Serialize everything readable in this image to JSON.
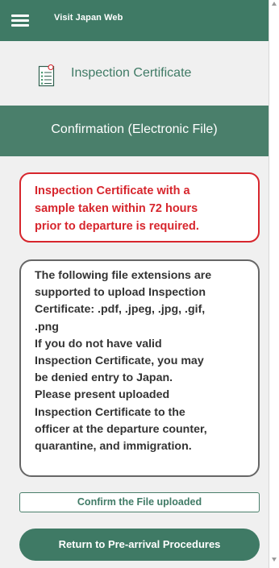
{
  "header": {
    "brand": "Visit Japan Web",
    "menu_icon": "hamburger-menu-icon"
  },
  "page": {
    "title": "Inspection Certificate",
    "title_icon": "document-checklist-icon"
  },
  "section": {
    "title": "Confirmation (Electronic File)"
  },
  "alert": {
    "lines": [
      "Inspection Certificate with a",
      "sample taken within 72 hours",
      "prior to departure is required."
    ],
    "color": "#d7262d"
  },
  "info": {
    "lines": [
      "The following file extensions are",
      "supported to upload Inspection",
      "Certificate: .pdf, .jpeg, .jpg, .gif,",
      ".png",
      "If you do not have valid",
      "Inspection Certificate, you may",
      "be denied entry to Japan.",
      "Please present uploaded",
      "Inspection Certificate to the",
      "officer at the departure counter,",
      "quarantine, and immigration."
    ]
  },
  "actions": {
    "confirm_label": "Confirm the File uploaded",
    "return_label": "Return to Pre-arrival Procedures"
  },
  "colors": {
    "brand_green": "#3f7a65",
    "section_green": "#4a7f6b",
    "background": "#f0f0f0"
  }
}
